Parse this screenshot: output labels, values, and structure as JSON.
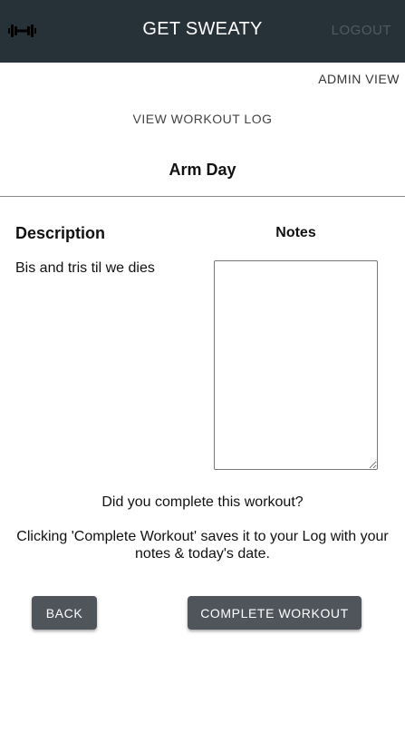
{
  "header": {
    "title": "GET SWEATY",
    "logout_label": "LOGOUT",
    "logo_icon": "dumbbell-icon"
  },
  "nav": {
    "admin_view_label": "ADMIN VIEW",
    "view_log_label": "VIEW WORKOUT LOG"
  },
  "workout": {
    "name": "Arm Day",
    "description_heading": "Description",
    "description": "Bis and tris til we dies",
    "notes_heading": "Notes",
    "notes_value": ""
  },
  "prompt": {
    "question": "Did you complete this workout?",
    "info": "Clicking 'Complete Workout' saves it to your Log with your notes & today's date."
  },
  "actions": {
    "back_label": "BACK",
    "complete_label": "COMPLETE WORKOUT"
  },
  "colors": {
    "appbar": "#263238",
    "button": "#50555b"
  }
}
